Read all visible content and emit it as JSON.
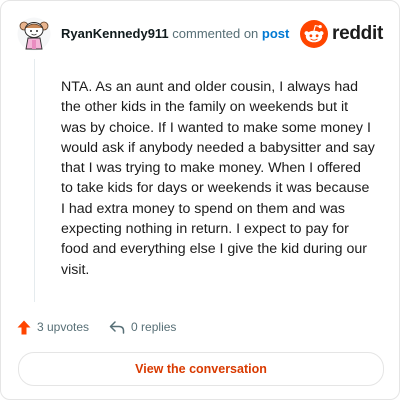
{
  "comment": {
    "author": "RyanKennedy911",
    "action_text": "commented on",
    "post_link": "post",
    "body": "NTA. As an aunt and older cousin, I always had the other kids in the family on weekends but it was by choice. If I wanted to make some money I would ask if anybody needed a babysitter and say that I was trying to make money. When I offered to take kids for days or weekends it was because I had extra money to spend on them and was expecting nothing in return. I expect to pay for food and everything else I give the kid during our visit."
  },
  "brand": {
    "name": "reddit",
    "color": "#ff4500",
    "icon": "reddit-snoo-icon"
  },
  "actions": {
    "upvotes": "3 upvotes",
    "replies": "0 replies",
    "upvote_icon": "upvote-arrow-icon",
    "reply_icon": "reply-arrow-icon"
  },
  "cta": {
    "label": "View the conversation",
    "color": "#d93a00"
  },
  "colors": {
    "link": "#0079d3",
    "upvote": "#ff4500",
    "muted": "#576f76"
  }
}
